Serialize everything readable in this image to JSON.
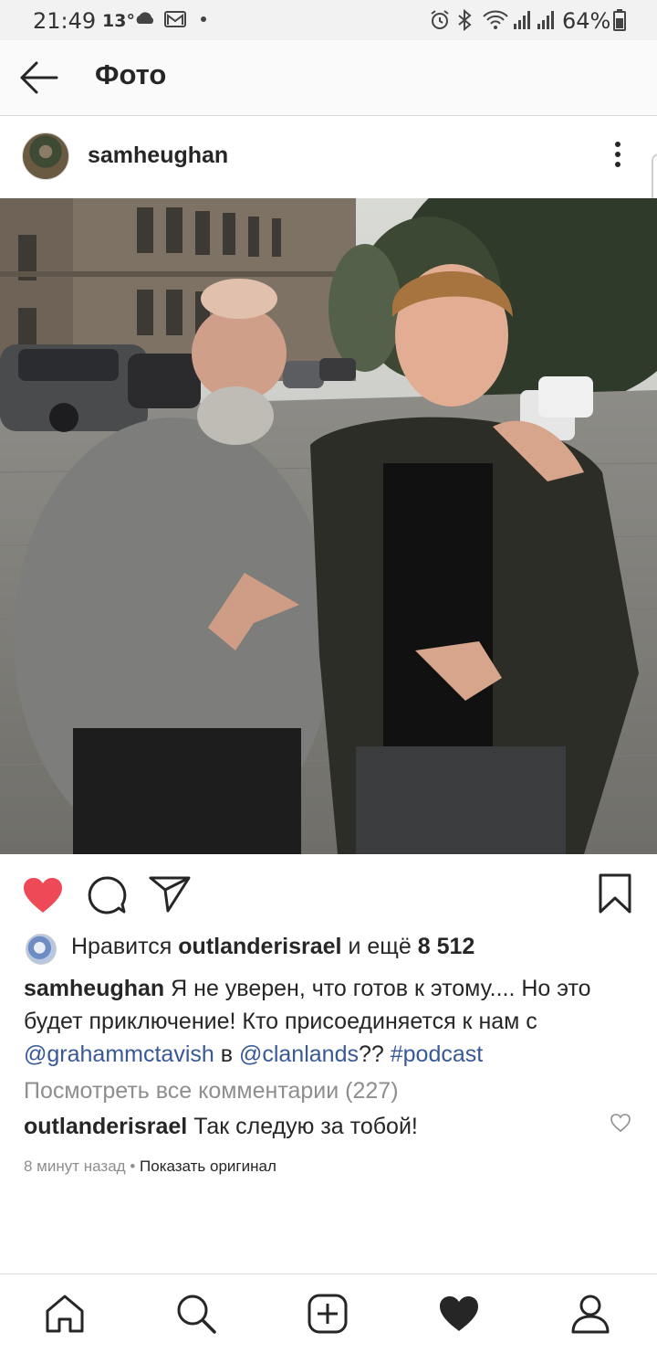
{
  "status_bar": {
    "time": "21:49",
    "temperature": "13°",
    "battery": "64%"
  },
  "app_bar": {
    "title": "Фото"
  },
  "post": {
    "username": "samheughan",
    "likes": {
      "prefix": "Нравится",
      "user": "outlanderisrael",
      "middle": "и ещё",
      "count": "8 512"
    },
    "caption": {
      "author": "samheughan",
      "text": "Я не уверен, что готов к этому.... Но это будет приключение! Кто присоединяется к нам с",
      "mention1": "@grahammctavish",
      "joiner": "в",
      "mention2": "@clanlands",
      "punct": "??",
      "hashtag": "#podcast"
    },
    "view_all_comments": "Посмотреть все комментарии (227)",
    "comment": {
      "author": "outlanderisrael",
      "text": "Так следую за тобой!"
    },
    "time_ago": "8 минут назад",
    "separator": "•",
    "show_original": "Показать оригинал"
  },
  "colors": {
    "like_red": "#ed4956",
    "link_blue": "#385898",
    "muted_gray": "#8e8e8e"
  }
}
